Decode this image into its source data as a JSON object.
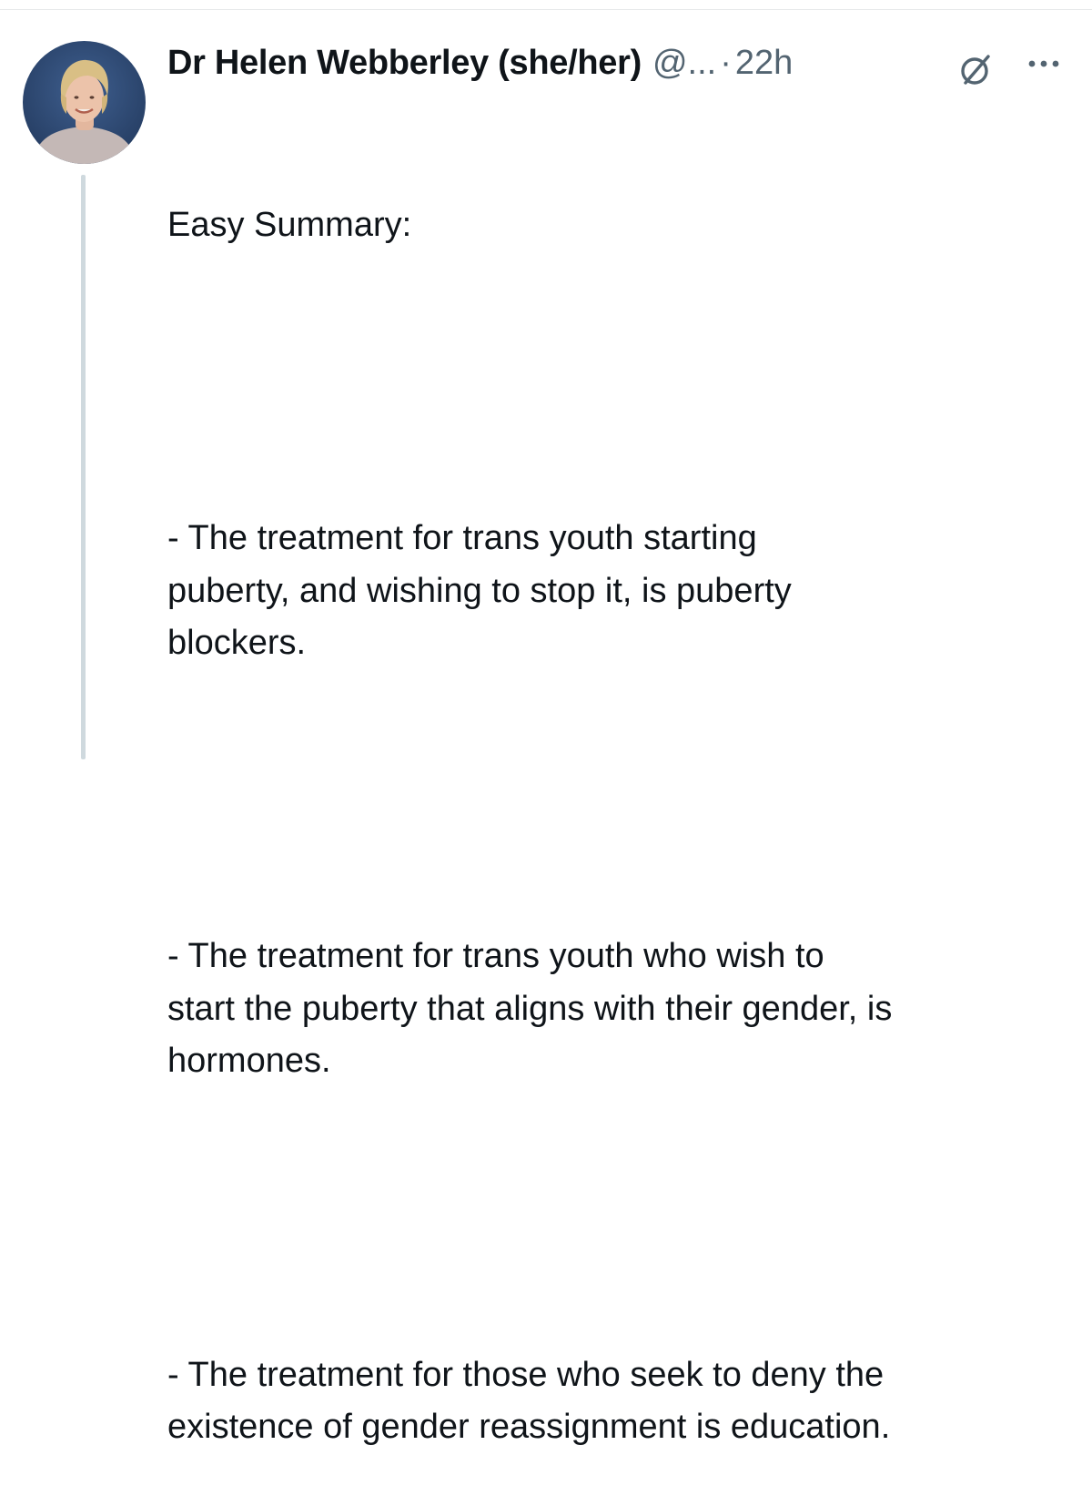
{
  "tweet": {
    "display_name": "Dr Helen Webberley (she/her)",
    "handle": "@...",
    "separator": "·",
    "timestamp": "22h",
    "icons": {
      "avatar": "profile-photo",
      "spark": "grok-spark-icon",
      "more": "more-options-icon"
    },
    "colors": {
      "text": "#0f1419",
      "secondary": "#536471",
      "thread_line": "#cfd9de"
    },
    "intro": "Easy Summary:",
    "paragraphs": [
      "- The treatment for trans youth starting\npuberty, and wishing to stop it, is puberty\nblockers.",
      "- The treatment for trans youth who wish to\nstart the puberty that aligns with their gender, is\nhormones.",
      "- The treatment for those who seek to deny the\nexistence of gender reassignment is education."
    ]
  }
}
